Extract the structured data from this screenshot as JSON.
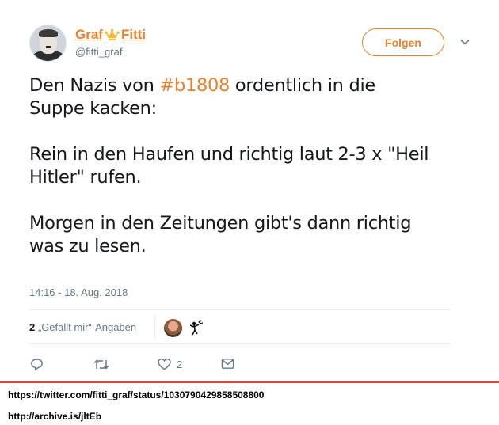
{
  "author": {
    "name_part1": "Graf",
    "name_part2": "Fitti",
    "handle": "@fitti_graf",
    "name_color": "#e8812d"
  },
  "follow_button": {
    "label": "Folgen"
  },
  "tweet": {
    "lines": [
      {
        "before": "Den Nazis von ",
        "hashtag": "#b1808",
        "after": " ordentlich in die"
      },
      {
        "text": "Suppe kacken:"
      },
      {
        "text": "Rein in den Haufen und richtig laut 2-3 x \"Heil"
      },
      {
        "text": "Hitler\" rufen."
      },
      {
        "text": "Morgen in den Zeitungen gibt's dann richtig"
      },
      {
        "text": "was zu lesen."
      }
    ],
    "timestamp": "14:16 - 18. Aug. 2018"
  },
  "engagement": {
    "likes_count": "2",
    "likes_label": "„Gefällt mir“-Angaben"
  },
  "actions": {
    "reply_icon": "reply-icon",
    "retweet_icon": "retweet-icon",
    "like_icon": "heart-icon",
    "like_count": "2",
    "dm_icon": "envelope-icon"
  },
  "sources": {
    "twitter_url": "https://twitter.com/fitti_graf/status/1030790429858508800",
    "archive_url": "http://archive.is/jltEb"
  },
  "colors": {
    "accent": "#e8812d",
    "divider": "#e24242",
    "muted": "#657786"
  }
}
